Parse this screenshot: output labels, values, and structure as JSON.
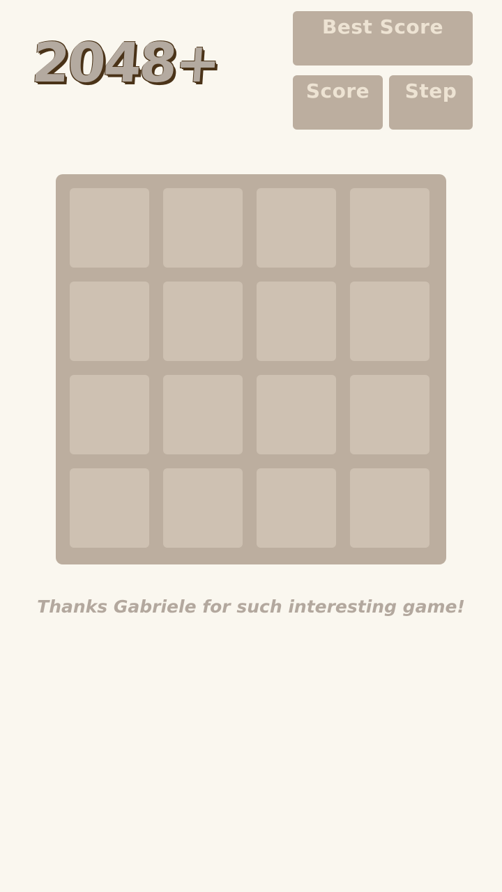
{
  "title": "2048+",
  "panels": {
    "best_label": "Best Score",
    "best_value": "",
    "score_label": "Score",
    "score_value": "",
    "step_label": "Step",
    "step_value": ""
  },
  "board": {
    "rows": [
      [
        "",
        "",
        "",
        ""
      ],
      [
        "",
        "",
        "",
        ""
      ],
      [
        "",
        "",
        "",
        ""
      ],
      [
        "",
        "",
        "",
        ""
      ]
    ]
  },
  "footer": {
    "message": "Thanks Gabriele for such interesting game!"
  },
  "colors": {
    "background": "#faf7ef",
    "panel": "#bcae9f",
    "empty_cell": "#cec1b2",
    "title_outline": "#4a3318",
    "footer_text": "#b3a89e"
  }
}
